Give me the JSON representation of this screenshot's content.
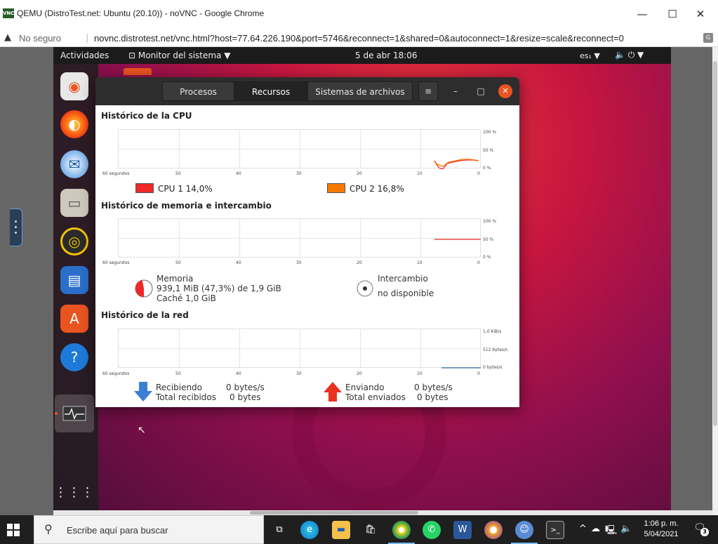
{
  "browser": {
    "title": "QEMU (DistroTest.net: Ubuntu (20.10)) - noVNC - Google Chrome",
    "favicon": "VNC",
    "minimize": "—",
    "maximize": "☐",
    "close": "✕",
    "not_secure": "No seguro",
    "url": "novnc.distrotest.net/vnc.html?host=77.64.226.190&port=5746&reconnect=1&shared=0&autoconnect=1&resize=scale&reconnect=0"
  },
  "ubuntu_topbar": {
    "activities": "Actividades",
    "app_menu": "Monitor del sistema ▼",
    "clock": "5 de abr  18:06",
    "language": "es₁ ▼",
    "system": "🔈 ⏻ ▼"
  },
  "system_monitor": {
    "tabs": [
      {
        "label": "Procesos",
        "active": false
      },
      {
        "label": "Recursos",
        "active": true
      },
      {
        "label": "Sistemas de archivos",
        "active": false
      }
    ],
    "menu_icon": "≡",
    "minimize": "–",
    "maximize": "□",
    "close": "✕",
    "x_ticks": [
      "60 segundos",
      "50",
      "40",
      "30",
      "20",
      "10",
      "0"
    ],
    "cpu": {
      "title": "Histórico de la CPU",
      "y_labels": [
        "100 %",
        "50 %",
        "0 %"
      ],
      "cpu1_label": "CPU 1  14,0%",
      "cpu2_label": "CPU 2  16,8%",
      "cpu1_color": "#ef2929",
      "cpu2_color": "#f57900"
    },
    "memory": {
      "title": "Histórico de memoria e intercambio",
      "y_labels": [
        "100 %",
        "50 %",
        "0 %"
      ],
      "mem_label": "Memoria",
      "mem_value": "939,1 MiB (47,3%) de 1,9 GiB",
      "cache": "Caché 1,0 GiB",
      "swap_label": "Intercambio",
      "swap_value": "no disponible"
    },
    "network": {
      "title": "Histórico de la red",
      "y_labels": [
        "1,0 KiB/s",
        "512 bytes/s",
        "0 bytes/s"
      ],
      "recv_label": "Recibiendo",
      "recv_total_label": "Total recibidos",
      "recv_value": "0 bytes/s",
      "recv_total": "0 bytes",
      "send_label": "Enviando",
      "send_total_label": "Total enviados",
      "send_value": "0 bytes/s",
      "send_total": "0 bytes"
    }
  },
  "taskbar": {
    "search_placeholder": "Escribe aquí para buscar",
    "time": "1:06 p. m.",
    "date": "5/04/2021",
    "notifications": "3"
  }
}
